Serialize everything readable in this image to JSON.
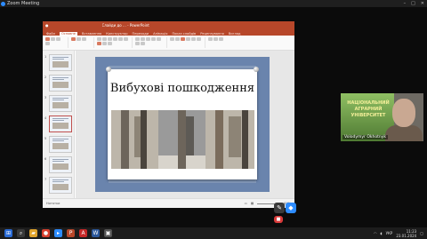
{
  "zoom": {
    "title": "Zoom Meeting"
  },
  "ppt": {
    "title": "Слайди до ... - PowerPoint",
    "tabs": [
      "Файл",
      "Основне",
      "Вставлення",
      "Конструктор",
      "Переходи",
      "Анімація",
      "Показ слайдів",
      "Рецензування",
      "Вигляд"
    ],
    "active_tab_index": 1,
    "slide_numbers": [
      "1",
      "2",
      "3",
      "4",
      "5",
      "6",
      "7"
    ],
    "selected_slide": "4",
    "status_left": "Нотатки",
    "zoom_level": "64%"
  },
  "slide": {
    "title": "Вибухові пошкодження"
  },
  "participant": {
    "banner_lines": [
      "НАЦІОНАЛЬНИЙ",
      "АГРАРНИЙ",
      "УНІВЕРСИТЕТ"
    ],
    "name": "Volodymyr Okhotnyk"
  },
  "taskbar": {
    "lang": "УКР",
    "time": "11:23",
    "date": "23.01.2024"
  },
  "colors": {
    "ppt_accent": "#b7472a",
    "slide_bg": "#6a84ad",
    "zoom_blue": "#2d8cff"
  }
}
